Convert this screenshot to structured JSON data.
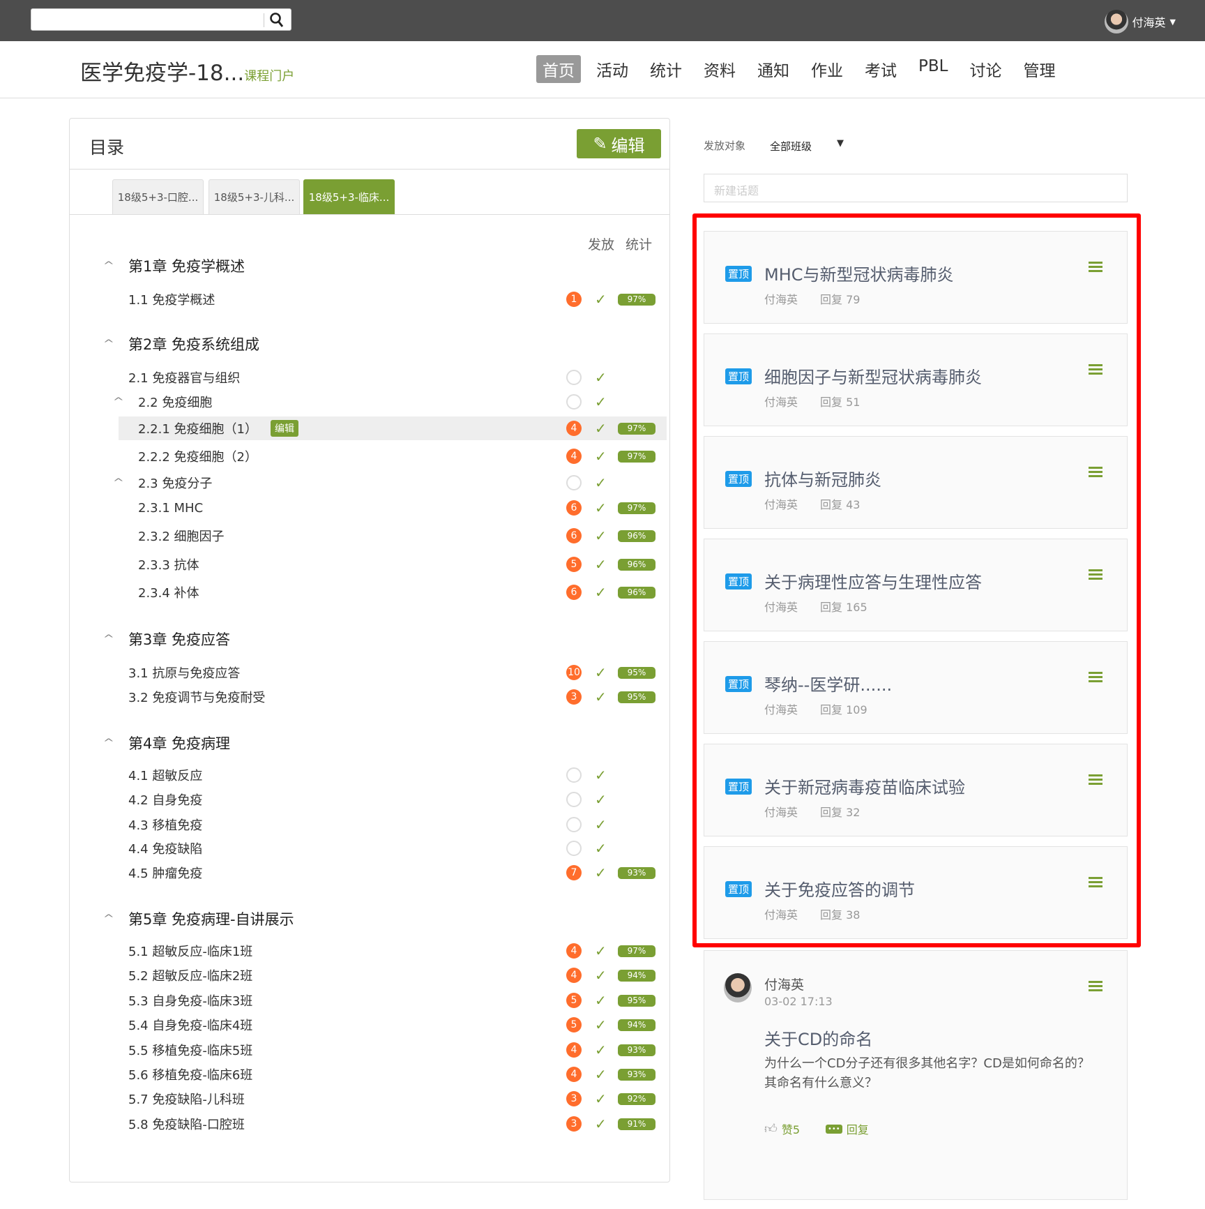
{
  "topbar": {
    "user": "付海英"
  },
  "header": {
    "title": "医学免疫学-18...",
    "portal": "课程门户",
    "nav": [
      "首页",
      "活动",
      "统计",
      "资料",
      "通知",
      "作业",
      "考试",
      "PBL",
      "讨论",
      "管理"
    ]
  },
  "toc": {
    "title": "目录",
    "edit": "编辑",
    "tabs": [
      "18级5+3-口腔...",
      "18级5+3-儿科...",
      "18级5+3-临床..."
    ],
    "col_release": "发放",
    "col_stats": "统计",
    "inline_edit": "编辑",
    "rows": [
      {
        "t": "ch",
        "label": "第1章 免疫学概述"
      },
      {
        "t": "sec",
        "label": "1.1  免疫学概述",
        "b": "1",
        "p": "97%"
      },
      {
        "t": "ch",
        "label": "第2章 免疫系统组成"
      },
      {
        "t": "sec",
        "label": "2.1 免疫器官与组织",
        "b": ""
      },
      {
        "t": "sub",
        "label": "2.2  免疫细胞",
        "b": "",
        "caret": true
      },
      {
        "t": "sub",
        "label": "2.2.1 免疫细胞（1）",
        "b": "4",
        "p": "97%",
        "hl": true
      },
      {
        "t": "sub",
        "label": "2.2.2 免疫细胞（2）",
        "b": "4",
        "p": "97%"
      },
      {
        "t": "sub",
        "label": "2.3  免疫分子",
        "b": "",
        "caret": true
      },
      {
        "t": "sub",
        "label": "2.3.1 MHC",
        "b": "6",
        "p": "97%"
      },
      {
        "t": "sub",
        "label": "2.3.2 细胞因子",
        "b": "6",
        "p": "96%"
      },
      {
        "t": "sub",
        "label": "2.3.3 抗体",
        "b": "5",
        "p": "96%"
      },
      {
        "t": "sub",
        "label": "2.3.4 补体",
        "b": "6",
        "p": "96%"
      },
      {
        "t": "ch",
        "label": "第3章 免疫应答"
      },
      {
        "t": "sec",
        "label": "3.1  抗原与免疫应答",
        "b": "10",
        "p": "95%"
      },
      {
        "t": "sec",
        "label": "3.2  免疫调节与免疫耐受",
        "b": "3",
        "p": "95%"
      },
      {
        "t": "ch",
        "label": "第4章 免疫病理"
      },
      {
        "t": "sec",
        "label": "4.1  超敏反应",
        "b": ""
      },
      {
        "t": "sec",
        "label": "4.2  自身免疫",
        "b": ""
      },
      {
        "t": "sec",
        "label": "4.3  移植免疫",
        "b": ""
      },
      {
        "t": "sec",
        "label": "4.4  免疫缺陷",
        "b": ""
      },
      {
        "t": "sec",
        "label": "4.5  肿瘤免疫",
        "b": "7",
        "p": "93%"
      },
      {
        "t": "ch",
        "label": "第5章 免疫病理-自讲展示"
      },
      {
        "t": "sec",
        "label": "5.1  超敏反应-临床1班",
        "b": "4",
        "p": "97%"
      },
      {
        "t": "sec",
        "label": "5.2  超敏反应-临床2班",
        "b": "4",
        "p": "94%"
      },
      {
        "t": "sec",
        "label": "5.3  自身免疫-临床3班",
        "b": "5",
        "p": "95%"
      },
      {
        "t": "sec",
        "label": "5.4  自身免疫-临床4班",
        "b": "5",
        "p": "94%"
      },
      {
        "t": "sec",
        "label": "5.5  移植免疫-临床5班",
        "b": "4",
        "p": "93%"
      },
      {
        "t": "sec",
        "label": "5.6  移植免疫-临床6班",
        "b": "4",
        "p": "93%"
      },
      {
        "t": "sec",
        "label": "5.7  免疫缺陷-儿科班",
        "b": "3",
        "p": "92%"
      },
      {
        "t": "sec",
        "label": "5.8  免疫缺陷-口腔班",
        "b": "3",
        "p": "91%"
      }
    ]
  },
  "discussion": {
    "target_label": "发放对象",
    "target_value": "全部班级",
    "new_topic_placeholder": "新建话题",
    "pin_label": "置顶",
    "topics": [
      {
        "title": "MHC与新型冠状病毒肺炎",
        "author": "付海英",
        "replies": "回复 79"
      },
      {
        "title": "细胞因子与新型冠状病毒肺炎",
        "author": "付海英",
        "replies": "回复 51"
      },
      {
        "title": "抗体与新冠肺炎",
        "author": "付海英",
        "replies": "回复 43"
      },
      {
        "title": "关于病理性应答与生理性应答",
        "author": "付海英",
        "replies": "回复 165"
      },
      {
        "title": "琴纳--医学研......",
        "author": "付海英",
        "replies": "回复 109"
      },
      {
        "title": "关于新冠病毒疫苗临床试验",
        "author": "付海英",
        "replies": "回复 32"
      },
      {
        "title": "关于免疫应答的调节",
        "author": "付海英",
        "replies": "回复 38"
      }
    ],
    "post": {
      "author": "付海英",
      "time": "03-02 17:13",
      "title": "关于CD的命名",
      "body1": "为什么一个CD分子还有很多其他名字？CD是如何命名的？",
      "body2": "其命名有什么意义？",
      "like": "赞5",
      "reply": "回复"
    }
  },
  "colors": {
    "accent": "#7a9f33",
    "badge": "#ff6d2c",
    "pin": "#1e9be9",
    "highlight": "#ff0000"
  }
}
